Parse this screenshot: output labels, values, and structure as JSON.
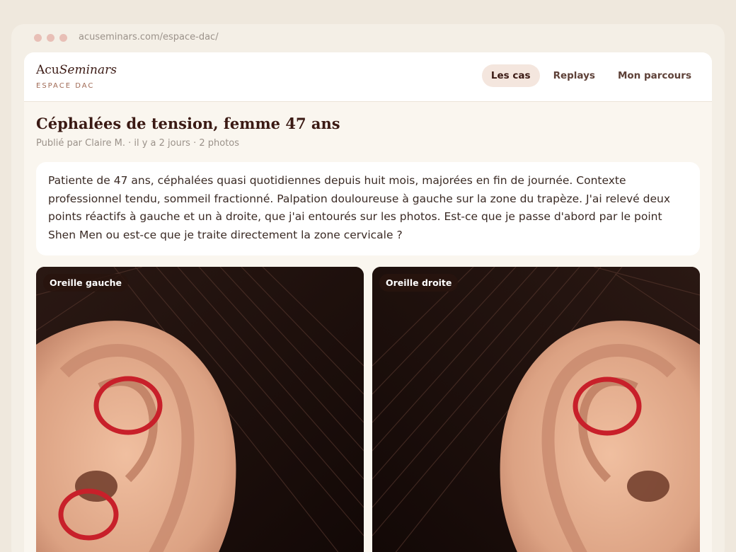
{
  "browser": {
    "url": "acuseminars.com/espace-dac/"
  },
  "brand": {
    "name_plain": "Acu",
    "name_italic": "Seminars",
    "subtitle": "ESPACE DAC"
  },
  "nav": {
    "items": [
      "Les cas",
      "Replays",
      "Mon parcours"
    ],
    "active": "Les cas"
  },
  "case": {
    "title": "Céphalées de tension, femme 47 ans",
    "meta": "Publié par Claire M. · il y a 2 jours · 2 photos",
    "body": "Patiente de 47 ans, céphalées quasi quotidiennes depuis huit mois, majorées en fin de journée. Contexte professionnel tendu, sommeil fractionné. Palpation douloureuse à gauche sur la zone du trapèze. J'ai relevé deux points réactifs à gauche et un à droite, que j'ai entourés sur les photos. Est-ce que je passe d'abord par le point Shen Men ou est-ce que je traite directement la zone cervicale ?"
  },
  "photos": [
    {
      "label": "Oreille gauche",
      "markers": 2
    },
    {
      "label": "Oreille droite",
      "markers": 1
    }
  ],
  "colors": {
    "accent": "#c8202a",
    "text": "#3b1a14",
    "active_nav_bg": "#f4e6de"
  }
}
